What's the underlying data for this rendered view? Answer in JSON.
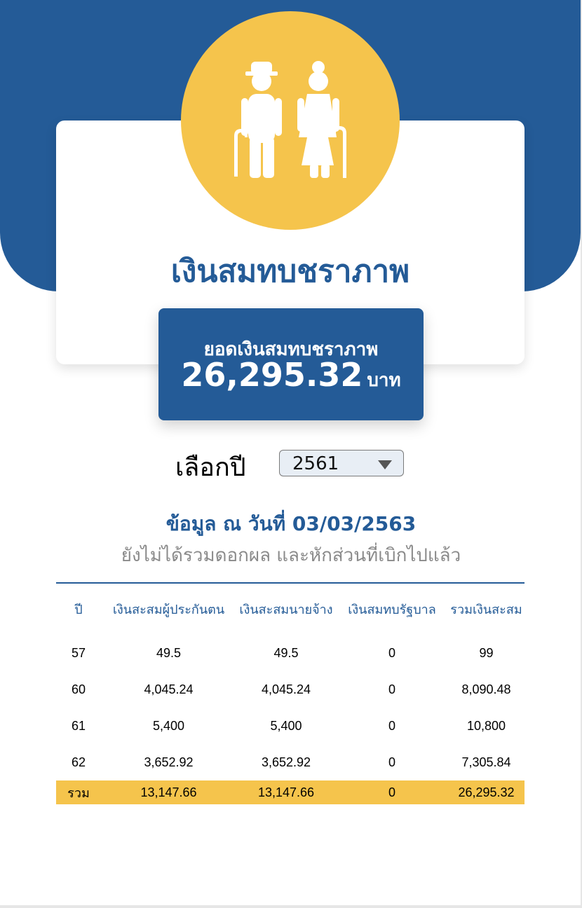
{
  "header": {
    "title": "เงินสมทบชราภาพ",
    "icon": "elderly-couple-icon",
    "colors": {
      "primary": "#245b97",
      "accent": "#f5c44c"
    }
  },
  "balance": {
    "label": "ยอดเงินสมทบชราภาพ",
    "amount": "26,295.32",
    "unit": "บาท"
  },
  "year_selector": {
    "label": "เลือกปี",
    "selected": "2561"
  },
  "info": {
    "date_text": "ข้อมูล ณ วันที่ 03/03/2563",
    "note": "ยังไม่ได้รวมดอกผล และหักส่วนที่เบิกไปแล้ว"
  },
  "table": {
    "headers": [
      "ปี",
      "เงินสะสมผู้ประกันตน",
      "เงินสะสมนายจ้าง",
      "เงินสมทบรัฐบาล",
      "รวมเงินสะสม"
    ],
    "rows": [
      [
        "57",
        "49.5",
        "49.5",
        "0",
        "99"
      ],
      [
        "60",
        "4,045.24",
        "4,045.24",
        "0",
        "8,090.48"
      ],
      [
        "61",
        "5,400",
        "5,400",
        "0",
        "10,800"
      ],
      [
        "62",
        "3,652.92",
        "3,652.92",
        "0",
        "7,305.84"
      ]
    ],
    "total": [
      "รวม",
      "13,147.66",
      "13,147.66",
      "0",
      "26,295.32"
    ]
  }
}
